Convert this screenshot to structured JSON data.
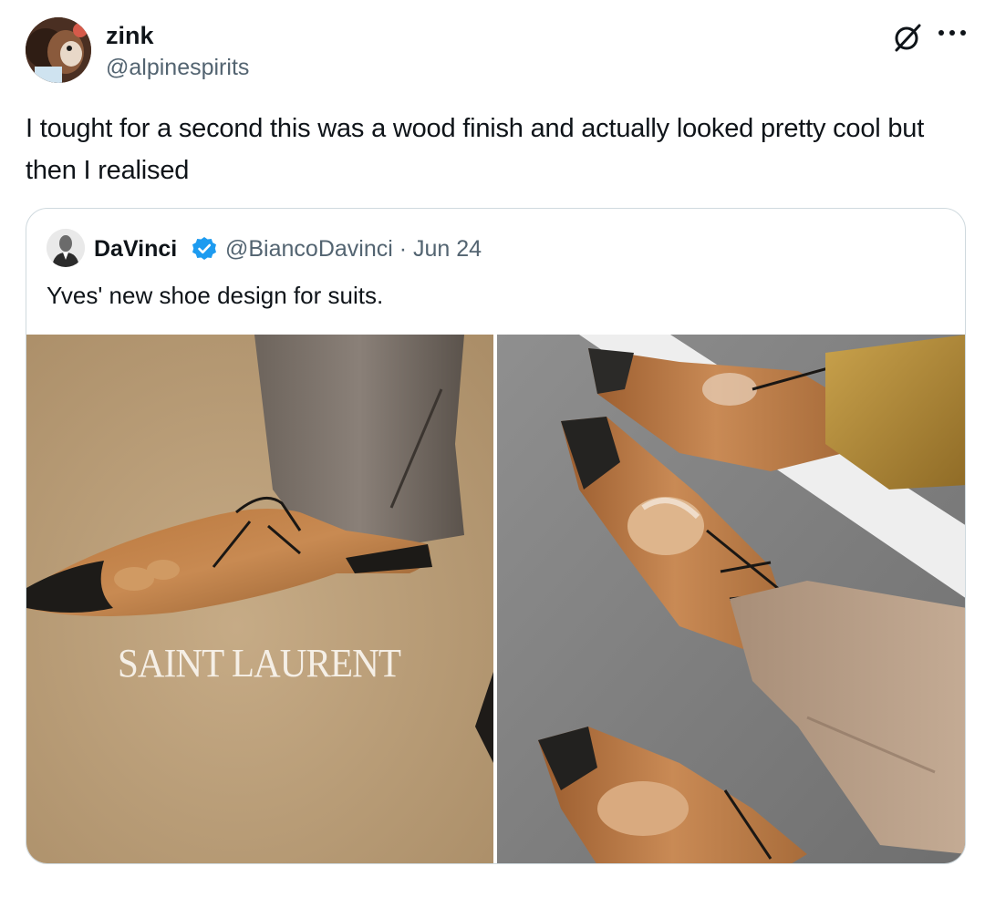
{
  "author": {
    "display_name": "zink",
    "handle": "@alpinespirits",
    "avatar_icon": "avatar-icon"
  },
  "tweet": {
    "text": "I tought for a second this was a wood finish and actually looked pretty cool but then I realised"
  },
  "quoted": {
    "display_name": "DaVinci",
    "verified_icon": "verified-badge-icon",
    "handle_date": "@BiancoDavinci · Jun 24",
    "text": "Yves' new shoe design for suits.",
    "photo_left_brand": "SAINT LAURENT"
  },
  "colors": {
    "text": "#0f1419",
    "secondary": "#536471",
    "border": "#cfd9de",
    "verified": "#1d9bf0"
  }
}
